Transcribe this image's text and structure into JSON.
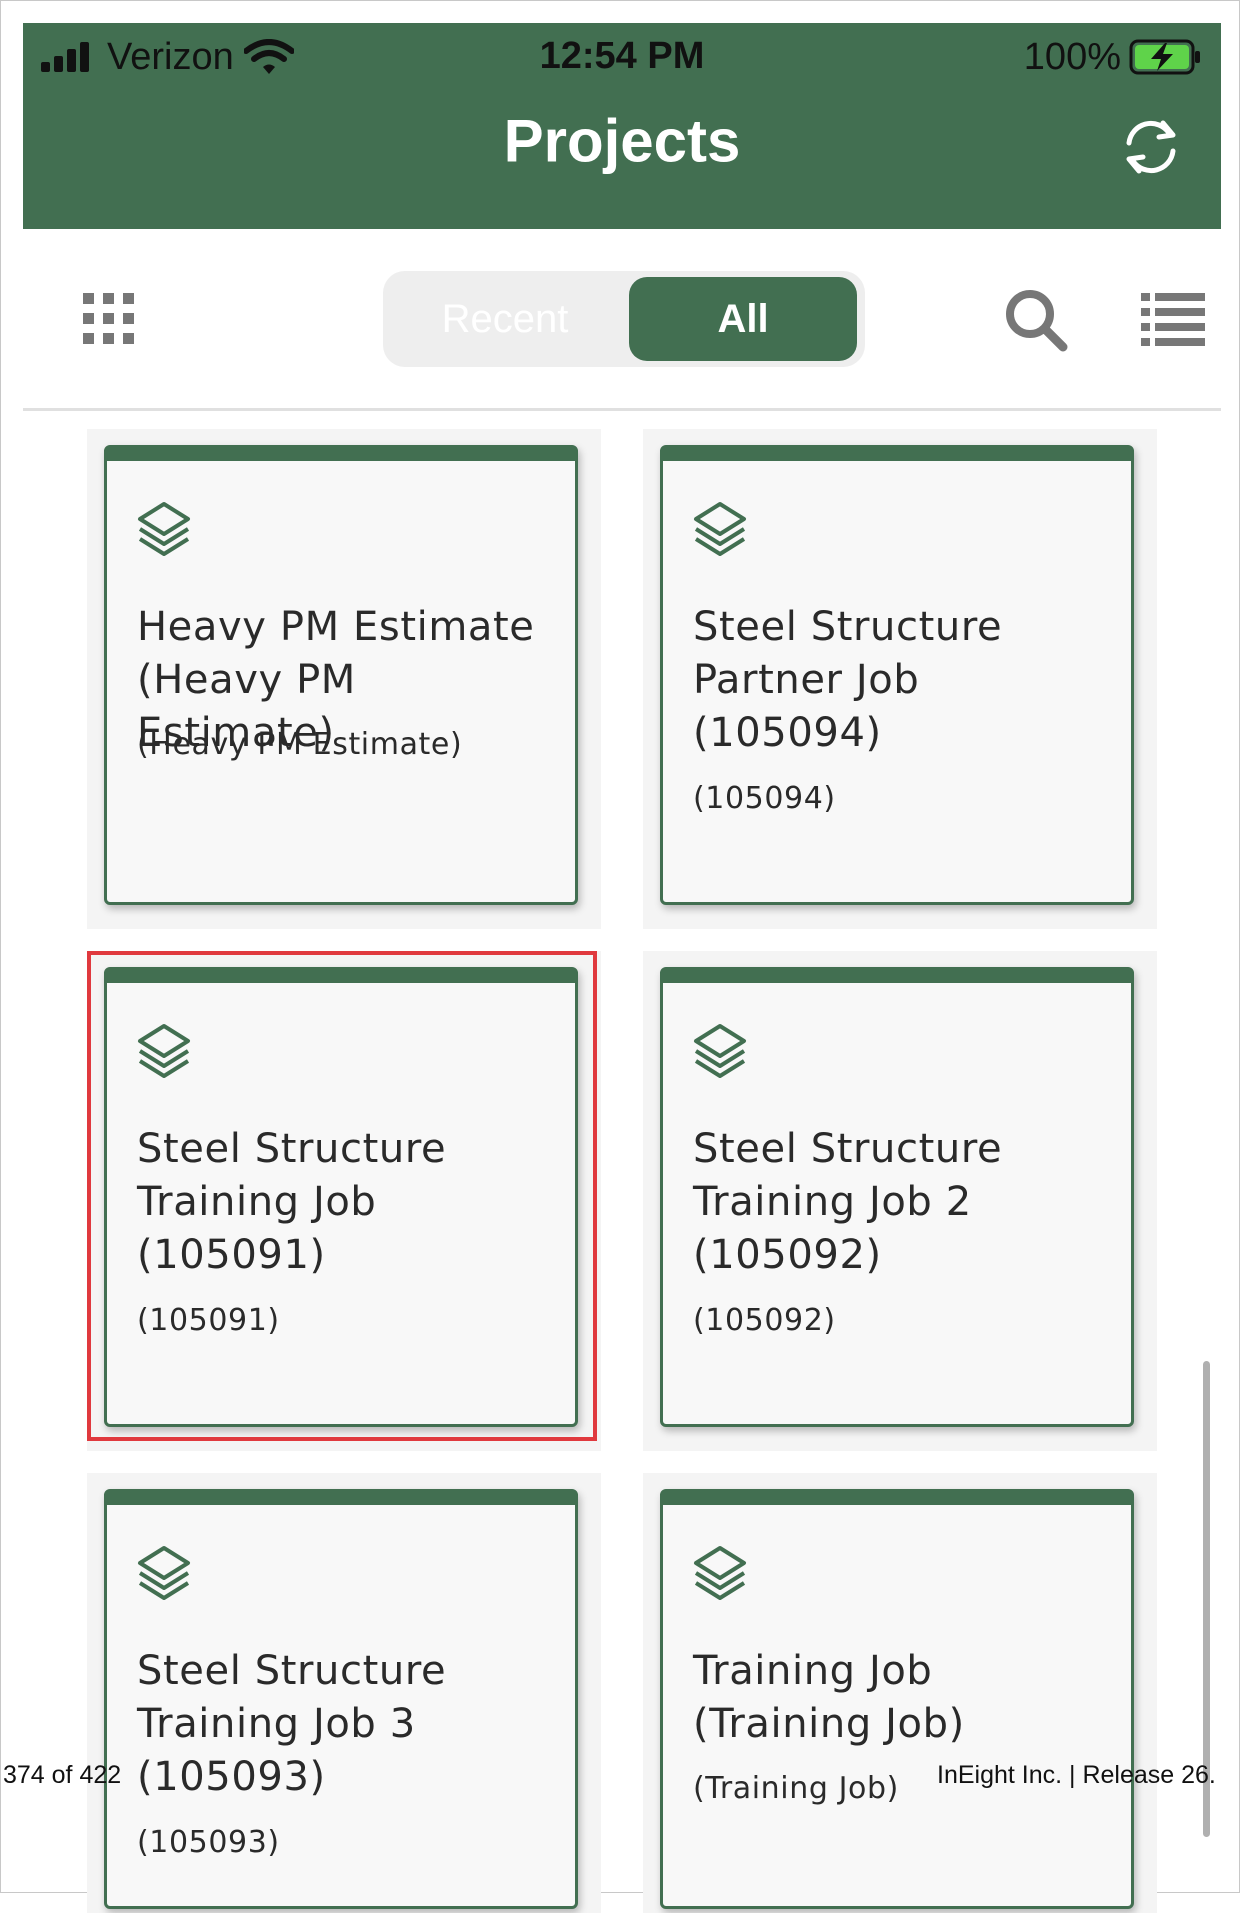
{
  "status_bar": {
    "carrier": "Verizon",
    "time": "12:54 PM",
    "battery": "100%"
  },
  "header": {
    "title": "Projects",
    "refresh_icon": "refresh-icon",
    "color": "#426f51"
  },
  "toolbar": {
    "grid_icon": "grid-icon",
    "segment": {
      "recent_label": "Recent",
      "all_label": "All",
      "selected": "All"
    },
    "search_icon": "search-icon",
    "list_icon": "list-view-icon"
  },
  "projects": [
    {
      "title": "Heavy PM Estimate (Heavy PM Estimate)",
      "subtitle": "(Heavy PM Estimate)",
      "icon": "layers-icon"
    },
    {
      "title": "Steel Structure Partner Job (105094)",
      "subtitle": "(105094)",
      "icon": "layers-icon"
    },
    {
      "title": "Steel Structure Training Job (105091)",
      "subtitle": "(105091)",
      "icon": "layers-icon",
      "highlighted": true
    },
    {
      "title": "Steel Structure Training Job 2 (105092)",
      "subtitle": "(105092)",
      "icon": "layers-icon"
    },
    {
      "title": "Steel Structure Training Job 3 (105093)",
      "subtitle": "(105093)",
      "icon": "layers-icon"
    },
    {
      "title": "Training Job (Training Job)",
      "subtitle": "(Training Job)",
      "icon": "layers-icon"
    }
  ],
  "footer": {
    "page": "374 of 422",
    "company": "InEight Inc.  |  Release 26."
  },
  "colors": {
    "accent": "#426f51",
    "highlight": "#e0393e"
  }
}
